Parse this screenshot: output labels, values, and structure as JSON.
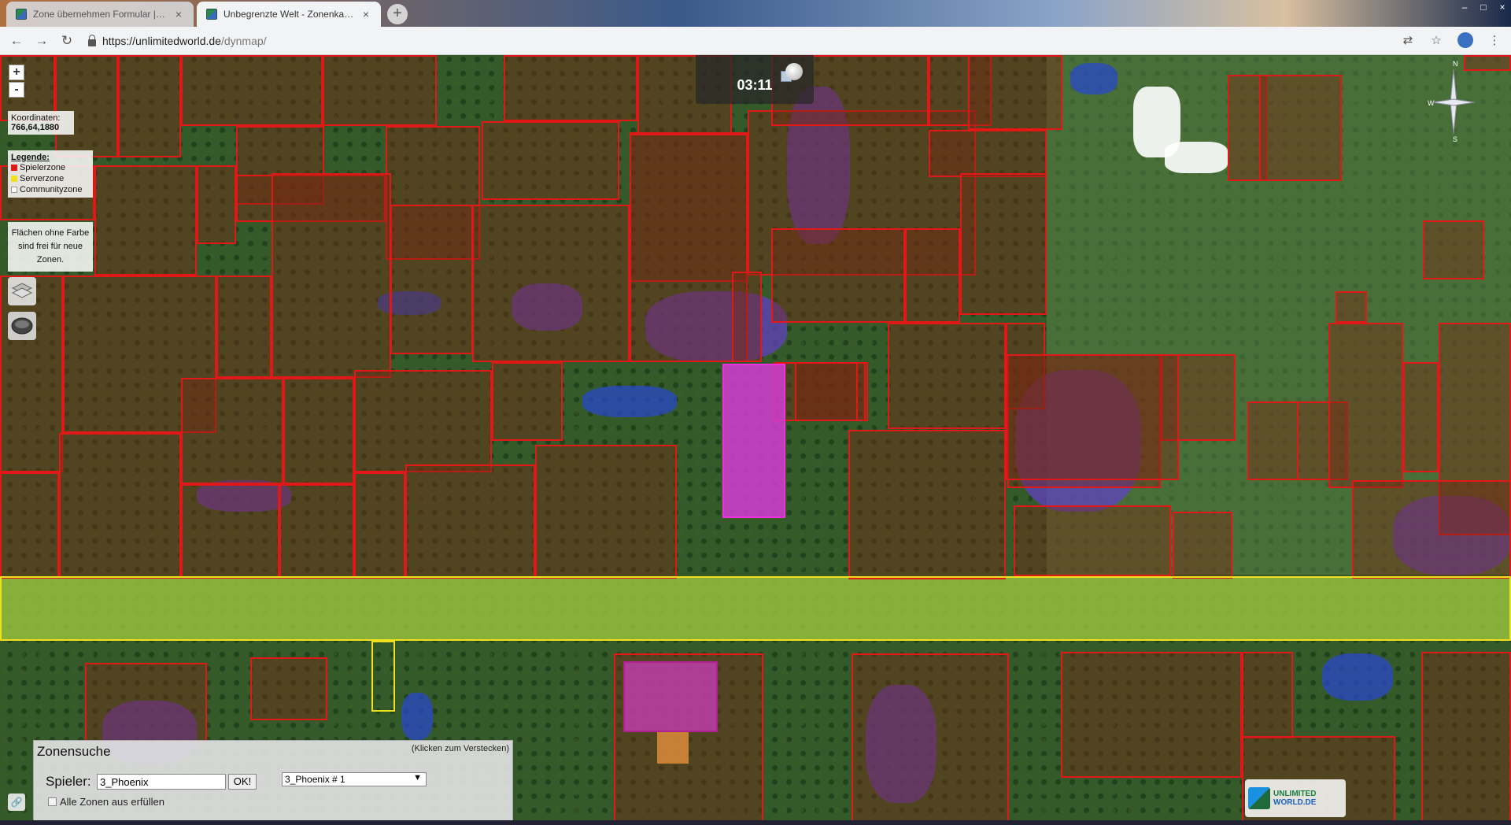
{
  "browser": {
    "tabs": [
      {
        "title": "Zone übernehmen Formular | Un",
        "active": false
      },
      {
        "title": "Unbegrenzte Welt - Zonenkarte",
        "active": true
      }
    ],
    "new_tab": "+",
    "close": "×",
    "url_host": "https://unlimitedworld.de",
    "url_path": "/dynmap/",
    "nav": {
      "back": "←",
      "forward": "→",
      "reload": "↻"
    },
    "window_controls": {
      "minimize": "–",
      "maximize": "□",
      "close": "×"
    },
    "right_icons": {
      "translate": "⇄",
      "bookmark": "☆",
      "menu": "⋮"
    }
  },
  "map": {
    "zoom_in": "+",
    "zoom_out": "-",
    "coordinates_label": "Koordinaten:",
    "coordinates_value": "766,64,1880",
    "legend": {
      "title": "Legende:",
      "items": [
        {
          "label": "Spielerzone",
          "color": "#e01818"
        },
        {
          "label": "Serverzone",
          "color": "#f0e020"
        },
        {
          "label": "Communityzone",
          "color": "#ffffff"
        }
      ]
    },
    "free_area_note": "Flächen ohne Farbe sind frei für neue Zonen.",
    "clock": "03:11",
    "compass": {
      "north": "N",
      "south": "S",
      "west": "W"
    }
  },
  "zone_search": {
    "title": "Zonensuche",
    "hide_hint": "(Klicken zum Verstecken)",
    "player_label": "Spieler:",
    "player_value": "3_Phoenix",
    "ok_label": "OK!",
    "selected_zone": "3_Phoenix # 1",
    "fill_all_label": "Alle Zonen aus erfüllen"
  },
  "logo": {
    "line1": "UNLIMITED",
    "line2": "WORLD.DE"
  }
}
